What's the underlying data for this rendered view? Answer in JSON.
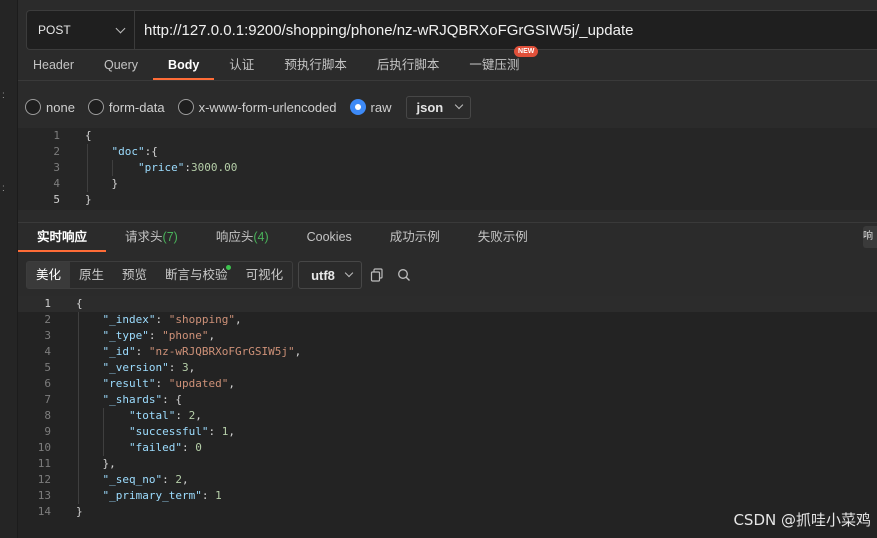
{
  "request": {
    "method": "POST",
    "url": "http://127.0.0.1:9200/shopping/phone/nz-wRJQBRXoFGrGSIW5j/_update"
  },
  "request_tabs": [
    "Header",
    "Query",
    "Body",
    "认证",
    "预执行脚本",
    "后执行脚本",
    "一键压测"
  ],
  "new_badge": "NEW",
  "body_types": {
    "none": "none",
    "form_data": "form-data",
    "urlencoded": "x-www-form-urlencoded",
    "raw": "raw",
    "format": "json"
  },
  "request_body": {
    "line_numbers": [
      "1",
      "2",
      "3",
      "4",
      "5"
    ],
    "l1": "{",
    "l2_key": "\"doc\"",
    "l2_rest": ":{",
    "l3_key": "\"price\"",
    "l3_colon": ":",
    "l3_val": "3000.00",
    "l4": "}",
    "l5": "}"
  },
  "response_tabs": {
    "realtime": "实时响应",
    "req_headers": "请求头",
    "req_headers_count": "(7)",
    "resp_headers": "响应头",
    "resp_headers_count": "(4)",
    "cookies": "Cookies",
    "success_example": "成功示例",
    "fail_example": "失败示例",
    "side": "响"
  },
  "view_modes": [
    "美化",
    "原生",
    "预览",
    "断言与校验",
    "可视化"
  ],
  "encoding": "utf8",
  "response_body": {
    "line_numbers": [
      "1",
      "2",
      "3",
      "4",
      "5",
      "6",
      "7",
      "8",
      "9",
      "10",
      "11",
      "12",
      "13",
      "14"
    ],
    "index_key": "\"_index\"",
    "index_val": "\"shopping\"",
    "type_key": "\"_type\"",
    "type_val": "\"phone\"",
    "id_key": "\"_id\"",
    "id_val": "\"nz-wRJQBRXoFGrGSIW5j\"",
    "version_key": "\"_version\"",
    "version_val": "3",
    "result_key": "\"result\"",
    "result_val": "\"updated\"",
    "shards_key": "\"_shards\"",
    "total_key": "\"total\"",
    "total_val": "2",
    "successful_key": "\"successful\"",
    "successful_val": "1",
    "failed_key": "\"failed\"",
    "failed_val": "0",
    "seq_key": "\"_seq_no\"",
    "seq_val": "2",
    "term_key": "\"_primary_term\"",
    "term_val": "1"
  },
  "watermark": "CSDN @抓哇小菜鸡",
  "colors": {
    "accent": "#ff6c37",
    "radio_checked": "#3d8af7",
    "count_green": "#49b25a",
    "new_badge": "#e0503a"
  }
}
